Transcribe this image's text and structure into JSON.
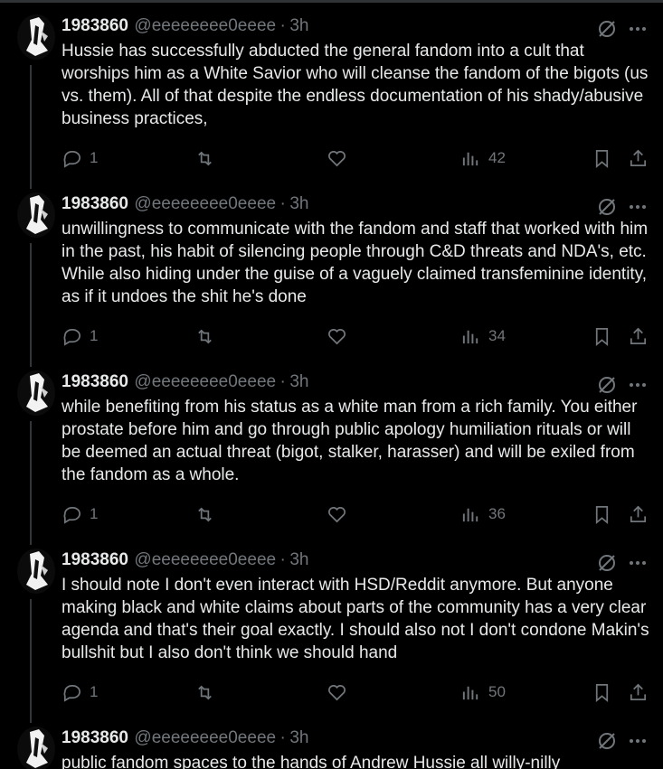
{
  "tweets": [
    {
      "name": "1983860",
      "handle": "@eeeeeeee0eeee",
      "sep": "·",
      "time": "3h",
      "text": "Hussie has successfully abducted the general fandom into a cult that worships him as a White Savior who will cleanse the fandom of the bigots (us vs. them). All of that despite the endless documentation of his shady/abusive business practices,",
      "replies": "1",
      "views": "42"
    },
    {
      "name": "1983860",
      "handle": "@eeeeeeee0eeee",
      "sep": "·",
      "time": "3h",
      "text": "unwillingness to communicate with the fandom and staff that worked with him in the past, his habit of silencing people through C&D threats and NDA's, etc. While also hiding under the guise of a vaguely claimed transfeminine identity, as if it undoes the shit he's done",
      "replies": "1",
      "views": "34"
    },
    {
      "name": "1983860",
      "handle": "@eeeeeeee0eeee",
      "sep": "·",
      "time": "3h",
      "text": "while benefiting from his status as a white man from a rich family. You either prostate before him and go through public apology humiliation rituals or will be deemed an actual threat (bigot, stalker, harasser) and will be exiled from the fandom as a whole.",
      "replies": "1",
      "views": "36"
    },
    {
      "name": "1983860",
      "handle": "@eeeeeeee0eeee",
      "sep": "·",
      "time": "3h",
      "text": "I should note I don't even interact with HSD/Reddit anymore. But anyone making black and white claims about parts of the community has a very clear agenda and that's their goal exactly. I should also not I don't condone Makin's bullshit but I also don't think we should hand",
      "replies": "1",
      "views": "50"
    },
    {
      "name": "1983860",
      "handle": "@eeeeeeee0eeee",
      "sep": "·",
      "time": "3h",
      "text": "public fandom spaces to the hands of Andrew Hussie all willy-nilly"
    }
  ],
  "icons": {
    "reply": "reply-icon",
    "retweet": "retweet-icon",
    "like": "like-icon",
    "views": "views-icon",
    "bookmark": "bookmark-icon",
    "share": "share-icon",
    "grok": "grok-icon",
    "more": "more-icon"
  },
  "colors": {
    "background": "#000000",
    "text": "#e7e9ea",
    "secondary": "#71767b",
    "divider": "#2f3336"
  }
}
